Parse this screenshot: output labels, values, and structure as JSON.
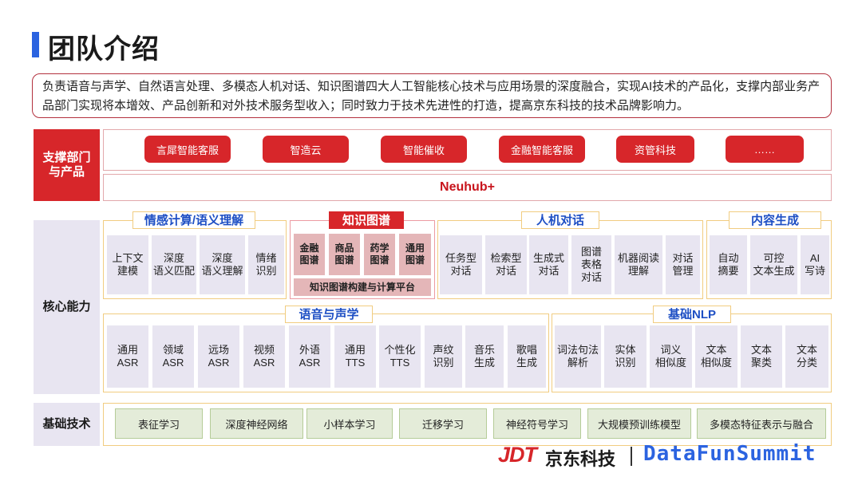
{
  "page": {
    "title": "团队介绍",
    "intro": "负责语音与声学、自然语言处理、多模态人机对话、知识图谱四大人工智能核心技术与应用场景的深度融合，实现AI技术的产品化，支撑内部业务产品部门实现将本增效、产品创新和对外技术服务型收入；同时致力于技术先进性的打造，提高京东科技的技术品牌影响力。"
  },
  "rows": {
    "support_label": "支撑部门与产品",
    "core_label": "核心能力",
    "foundation_label": "基础技术"
  },
  "products": [
    "言犀智能客服",
    "智造云",
    "智能催收",
    "金融智能客服",
    "资管科技",
    "……"
  ],
  "platform": "Neuhub+",
  "core": {
    "emotion": {
      "title": "情感计算/语义理解",
      "items": [
        "上下文\n建模",
        "深度\n语义匹配",
        "深度\n语义理解",
        "情绪\n识别"
      ]
    },
    "kg": {
      "title": "知识图谱",
      "items": [
        "金融\n图谱",
        "商品\n图谱",
        "药学\n图谱",
        "通用\n图谱"
      ],
      "platform": "知识图谱构建与计算平台"
    },
    "dialog": {
      "title": "人机对话",
      "items": [
        "任务型\n对话",
        "检索型\n对话",
        "生成式\n对话",
        "图谱\n表格\n对话",
        "机器阅读\n理解",
        "对话\n管理"
      ]
    },
    "content": {
      "title": "内容生成",
      "items": [
        "自动\n摘要",
        "可控\n文本生成",
        "AI\n写诗"
      ]
    },
    "speech": {
      "title": "语音与声学",
      "items": [
        "通用\nASR",
        "领域\nASR",
        "远场\nASR",
        "视频\nASR",
        "外语\nASR",
        "通用\nTTS",
        "个性化\nTTS",
        "声纹\n识别",
        "音乐\n生成",
        "歌唱\n生成"
      ]
    },
    "nlp": {
      "title": "基础NLP",
      "items": [
        "词法句法\n解析",
        "实体\n识别",
        "词义\n相似度",
        "文本\n相似度",
        "文本\n聚类",
        "文本\n分类"
      ]
    }
  },
  "foundation": [
    "表征学习",
    "深度神经网络",
    "小样本学习",
    "迁移学习",
    "神经符号学习",
    "大规模预训练模型",
    "多模态特征表示与融合"
  ],
  "logos": {
    "jdt": "JDT",
    "jd_name": "京东科技",
    "dfs": "DataFunSummit"
  },
  "colors": {
    "accent_red": "#d7262a",
    "accent_blue": "#2b63e0",
    "card_gray": "#e8e5f1",
    "card_pink": "#e4b6b8",
    "card_green": "#e4ecd9"
  }
}
